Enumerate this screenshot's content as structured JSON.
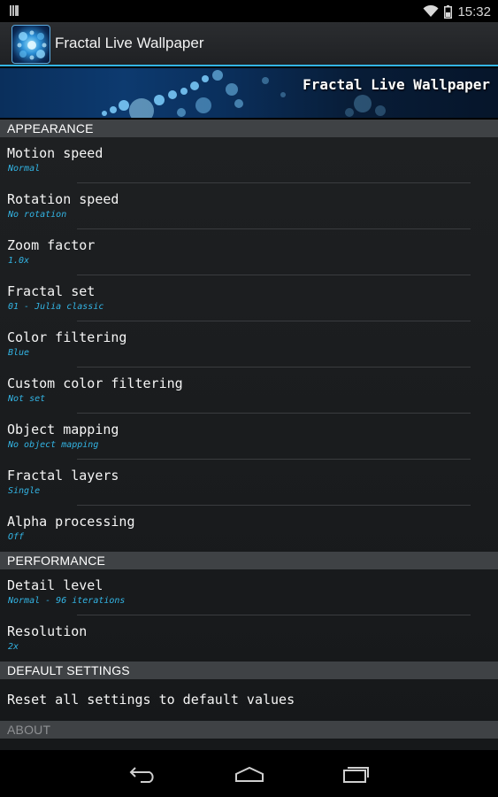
{
  "status_bar": {
    "time": "15:32",
    "icons": [
      "notification-icon",
      "wifi-icon",
      "battery-icon"
    ]
  },
  "action_bar": {
    "title": "Fractal Live Wallpaper",
    "app_icon": "fractal-app-icon"
  },
  "banner": {
    "title": "Fractal Live Wallpaper"
  },
  "sections": [
    {
      "title": "APPEARANCE",
      "items": [
        {
          "title": "Motion speed",
          "summary": "Normal"
        },
        {
          "title": "Rotation speed",
          "summary": "No rotation"
        },
        {
          "title": "Zoom factor",
          "summary": "1.0x"
        },
        {
          "title": "Fractal set",
          "summary": "01 - Julia classic"
        },
        {
          "title": "Color filtering",
          "summary": "Blue"
        },
        {
          "title": "Custom color filtering",
          "summary": "Not set"
        },
        {
          "title": "Object mapping",
          "summary": "No object mapping"
        },
        {
          "title": "Fractal layers",
          "summary": "Single"
        },
        {
          "title": "Alpha processing",
          "summary": "Off"
        }
      ]
    },
    {
      "title": "PERFORMANCE",
      "items": [
        {
          "title": "Detail level",
          "summary": "Normal - 96 iterations"
        },
        {
          "title": "Resolution",
          "summary": "2x"
        }
      ]
    },
    {
      "title": "DEFAULT SETTINGS",
      "items": [
        {
          "title": "Reset all settings to default values"
        }
      ]
    },
    {
      "title": "ABOUT",
      "items": []
    }
  ],
  "nav_bar": {
    "buttons": [
      "back-icon",
      "home-icon",
      "recent-apps-icon"
    ]
  },
  "colors": {
    "accent": "#33b5e5",
    "category_bg": "#3f4245",
    "list_bg": "#1e2022"
  }
}
